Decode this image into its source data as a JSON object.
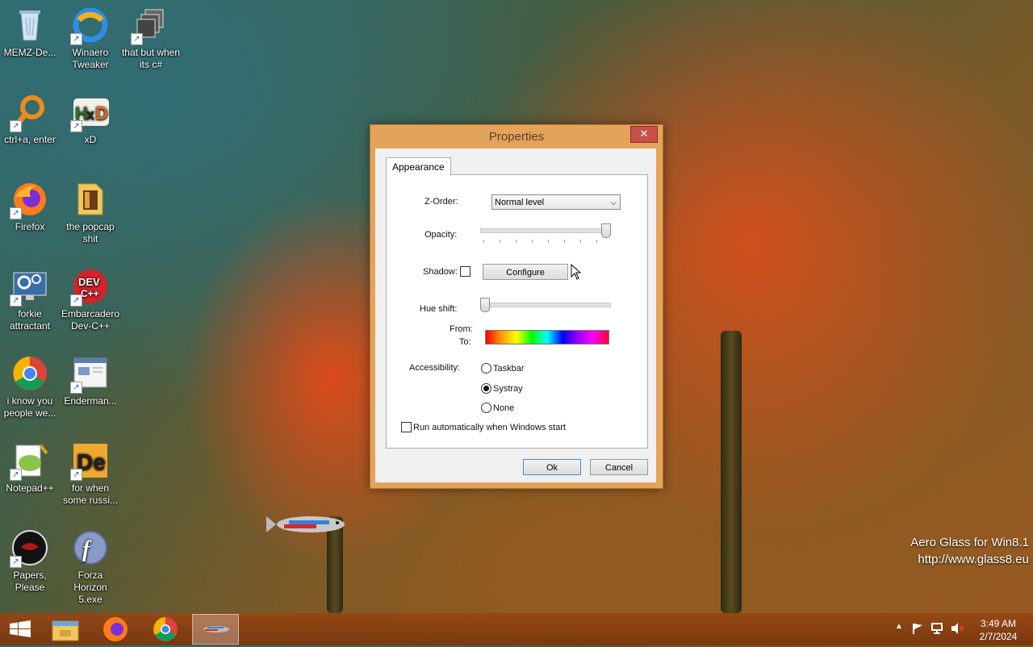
{
  "desktop": {
    "icons": [
      {
        "label": "MEMZ-De...",
        "icon": "recycle-bin-icon"
      },
      {
        "label": "Winaero Tweaker",
        "icon": "winaero-icon"
      },
      {
        "label": "that but when its c#",
        "icon": "windows-stack-icon"
      },
      {
        "label": "ctrl+a, enter",
        "icon": "magnifier-icon"
      },
      {
        "label": "xD",
        "icon": "hxd-icon"
      },
      {
        "label": "Firefox",
        "icon": "firefox-icon"
      },
      {
        "label": "the popcap shit",
        "icon": "folder-icon"
      },
      {
        "label": "forkie attractant",
        "icon": "monitor-gear-icon"
      },
      {
        "label": "Embarcadero Dev-C++",
        "icon": "devcpp-icon"
      },
      {
        "label": "i know you people we...",
        "icon": "chrome-icon"
      },
      {
        "label": "Enderman...",
        "icon": "window-app-icon"
      },
      {
        "label": "Notepad++",
        "icon": "notepadpp-icon"
      },
      {
        "label": "for when some russi...",
        "icon": "de-icon"
      },
      {
        "label": "Papers, Please",
        "icon": "papers-please-icon"
      },
      {
        "label": "Forza Horizon 5.exe",
        "icon": "flash-icon"
      }
    ],
    "watermark_line1": "Aero Glass for Win8.1",
    "watermark_line2": "http://www.glass8.eu"
  },
  "dialog": {
    "title": "Properties",
    "close_glyph": "✕",
    "tab": "Appearance",
    "zorder_label": "Z-Order:",
    "zorder_value": "Normal level",
    "opacity_label": "Opacity:",
    "opacity_value": 1.0,
    "shadow_label": "Shadow:",
    "shadow_checked": false,
    "configure_label": "Configure",
    "hue_label": "Hue shift:",
    "hue_value": 0.0,
    "from_label": "From:",
    "to_label": "To:",
    "accessibility_label": "Accessibility:",
    "radio_taskbar": "Taskbar",
    "radio_systray": "Systray",
    "radio_none": "None",
    "selected": "Systray",
    "autorun_label": "Run automatically when Windows start",
    "autorun_checked": false,
    "ok_label": "Ok",
    "cancel_label": "Cancel"
  },
  "taskbar": {
    "items": [
      "start-icon",
      "file-explorer-icon",
      "firefox-icon",
      "chrome-icon",
      "fish-app-icon"
    ],
    "time": "3:49 AM",
    "date": "2/7/2024"
  }
}
